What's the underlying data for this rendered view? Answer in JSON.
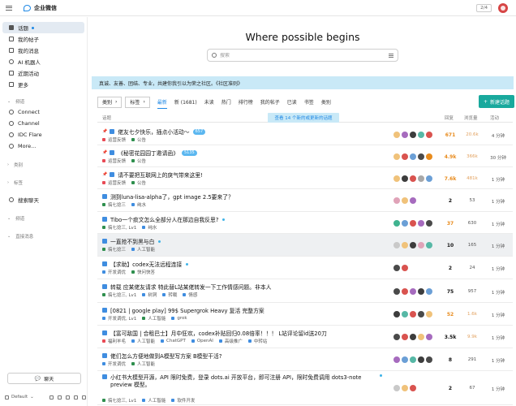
{
  "header": {
    "app_name": "企业微信",
    "page_counter": "2/4"
  },
  "sidebar": {
    "items_top": [
      {
        "label": "话题",
        "icon": "topics-icon",
        "active": true
      },
      {
        "label": "我的帖子",
        "icon": "my-posts-icon"
      },
      {
        "label": "我的消息",
        "icon": "messages-icon"
      },
      {
        "label": "AI 机器人",
        "icon": "robot-icon"
      },
      {
        "label": "近期活动",
        "icon": "calendar-icon"
      },
      {
        "label": "更多",
        "icon": "more-icon"
      }
    ],
    "section_channels": "频道",
    "channels": [
      {
        "label": "Connect"
      },
      {
        "label": "Channel"
      },
      {
        "label": "IDC Flare"
      },
      {
        "label": "More..."
      }
    ],
    "section_categories": "类别",
    "section_tags": "标签",
    "search_chat": "搜索聊天",
    "section_dm": "频道",
    "section_direct": "直接消息",
    "chat_button": "聊天",
    "footer_theme": "Default"
  },
  "main": {
    "hero_title": "Where possible begins",
    "search_placeholder": "搜索",
    "banner": "真诚、友善、团结、专业，共建你我引以为荣之社区。《社区准则》",
    "filters": {
      "category": "类别",
      "tags": "标签",
      "tabs": [
        "最新",
        "新 (1681)",
        "未读",
        "热门",
        "排行榜",
        "我的帖子",
        "已读",
        "书签",
        "类别"
      ],
      "new_topic": "新建话题"
    },
    "columns": {
      "topic": "话题",
      "replies": "回复",
      "views": "浏览量",
      "activity": "活动"
    },
    "new_topics_notice": "查看 14 个新的或更新的话题",
    "topics": [
      {
        "pinned": true,
        "title": "佬友七夕快乐，插点小活动～",
        "badge": "657",
        "tags": [
          "运营反馈",
          "公告"
        ],
        "tag_colors": [
          "#e94a55",
          "#2f8f4e"
        ],
        "replies": "671",
        "views": "20.6k",
        "activity": "4 分钟",
        "replies_color": "orange",
        "views_color": "orange2",
        "avatars": [
          "#f0c27a",
          "#a66bbe",
          "#3d3d3d",
          "#57b8a6",
          "#d9534f"
        ]
      },
      {
        "pinned": true,
        "title": "《秘密花园园丁邀请函》",
        "badge": "5135",
        "tags": [
          "运营反馈",
          "公告"
        ],
        "tag_colors": [
          "#e94a55",
          "#2f8f4e"
        ],
        "replies": "4.9k",
        "views": "366k",
        "activity": "30 分钟",
        "replies_color": "orange",
        "views_color": "orange2",
        "avatars": [
          "#f0c27a",
          "#d9534f",
          "#6b9fd6",
          "#4a4a4a",
          "#e88b1d"
        ]
      },
      {
        "pinned": true,
        "title": "请不要把互联网上的戾气带来这里!",
        "badge": "",
        "tags": [
          "运营反馈",
          "公告"
        ],
        "tag_colors": [
          "#e94a55",
          "#2f8f4e"
        ],
        "replies": "7.6k",
        "views": "481k",
        "activity": "1 分钟",
        "replies_color": "orange",
        "views_color": "orange2",
        "avatars": [
          "#f0c27a",
          "#3d3d3d",
          "#d9534f",
          "#a8a8a8",
          "#6b9fd6"
        ]
      },
      {
        "pinned": false,
        "title": "测到luna-lisa-alpha了，gpt image 2.5要来了？",
        "badge": "",
        "tags": [
          "搞七捻三",
          "纯水"
        ],
        "tag_colors": [
          "#2f8f4e",
          "#3f8de0"
        ],
        "replies": "2",
        "views": "53",
        "activity": "1 分钟",
        "avatars": [
          "#e0a3b8",
          "#f0c27a",
          "#a66bbe"
        ]
      },
      {
        "pinned": false,
        "title": "Tibo一个痰文怎么全部分人在那边自我反思?",
        "badge": "",
        "dot": true,
        "tags": [
          "搞七捻三, Lv1",
          "纯水"
        ],
        "tag_colors": [
          "#2f8f4e",
          "#3f8de0"
        ],
        "replies": "37",
        "views": "630",
        "activity": "1 分钟",
        "replies_color": "orange",
        "avatars": [
          "#3fb38f",
          "#6b9fd6",
          "#d9534f",
          "#a66bbe",
          "#4a4a4a"
        ]
      },
      {
        "pinned": false,
        "title": "一直抢不到黑与白",
        "badge": "",
        "dot": true,
        "highlight": true,
        "tags": [
          "搞七捻三",
          "人工智能"
        ],
        "tag_colors": [
          "#2f8f4e",
          "#3f8de0"
        ],
        "replies": "10",
        "views": "165",
        "activity": "1 分钟",
        "avatars": [
          "#c9c9c9",
          "#f0c27a",
          "#3d3d3d",
          "#e0a3b8",
          "#57b8a6"
        ]
      },
      {
        "pinned": false,
        "title": "【求助】codex无法远程连接",
        "badge": "",
        "dot": true,
        "tags": [
          "开发调优",
          "快问快答"
        ],
        "tag_colors": [
          "#3f8de0",
          "#2f8f4e"
        ],
        "replies": "2",
        "views": "24",
        "activity": "1 分钟",
        "avatars": [
          "#4a4a4a",
          "#d9534f"
        ]
      },
      {
        "pinned": false,
        "title": "转载 应某佬友请求 特此替L站某佬转发一下工作情感问题。非本人",
        "badge": "",
        "tags": [
          "搞七捻三, Lv1",
          "树洞",
          "转载",
          "情感"
        ],
        "tag_colors": [
          "#2f8f4e",
          "#3f8de0",
          "#3f8de0",
          "#3f8de0"
        ],
        "replies": "75",
        "views": "957",
        "activity": "1 分钟",
        "avatars": [
          "#4a4a4a",
          "#d9534f",
          "#a66bbe",
          "#3d3d3d",
          "#6b9fd6"
        ]
      },
      {
        "pinned": false,
        "title": "[0821 | google play] 99$ Supergrok Heavy 复活 完整方案",
        "badge": "",
        "tags": [
          "开发调优, Lv1",
          "人工智能",
          "grok"
        ],
        "tag_colors": [
          "#3f8de0",
          "#2f8f4e",
          "#3f8de0"
        ],
        "replies": "52",
        "views": "1.6k",
        "activity": "1 分钟",
        "replies_color": "orange",
        "views_color": "orange2",
        "avatars": [
          "#3d3d3d",
          "#57b8a6",
          "#d9534f",
          "#4a4a4a",
          "#f0c27a"
        ]
      },
      {
        "pinned": false,
        "title": "【富可敌国 | 合租巴士】月中狂欢，codex补贴回归0.08倍率！！！ L站评论留id送20刀",
        "badge": "",
        "tags": [
          "福利羊毛",
          "人工智能",
          "ChatGPT",
          "OpenAI",
          "高级推广",
          "中转站"
        ],
        "tag_colors": [
          "#e94a55",
          "#3f8de0",
          "#3f8de0",
          "#3f8de0",
          "#3f8de0",
          "#3f8de0"
        ],
        "replies": "3.5k",
        "views": "9.9k",
        "activity": "1 分钟",
        "views_color": "orange2",
        "avatars": [
          "#4a4a4a",
          "#d9534f",
          "#3d3d3d",
          "#f0c27a",
          "#a66bbe"
        ]
      },
      {
        "pinned": false,
        "title": "佬们怎么方便地做到A模型写方案 B模型干活?",
        "badge": "",
        "tags": [
          "开发调优",
          "人工智能"
        ],
        "tag_colors": [
          "#3f8de0",
          "#2f8f4e"
        ],
        "replies": "8",
        "views": "291",
        "activity": "1 分钟",
        "avatars": [
          "#a66bbe",
          "#6b9fd6",
          "#57b8a6",
          "#3d3d3d",
          "#4a4a4a"
        ]
      },
      {
        "pinned": false,
        "title": "小红书大模型开源，API 限时免费，登录 dots.ai 开放平台，即可注册 API，限时免费调用 dots3-note preview 模型。",
        "badge": "",
        "dot": true,
        "wrap": true,
        "tags": [
          "搞七捻三, Lv1",
          "人工智能",
          "软件开发"
        ],
        "tag_colors": [
          "#2f8f4e",
          "#3f8de0",
          "#3f8de0"
        ],
        "replies": "2",
        "views": "67",
        "activity": "1 分钟",
        "avatars": [
          "#c9c9c9",
          "#f0c27a",
          "#d9534f"
        ]
      }
    ]
  }
}
